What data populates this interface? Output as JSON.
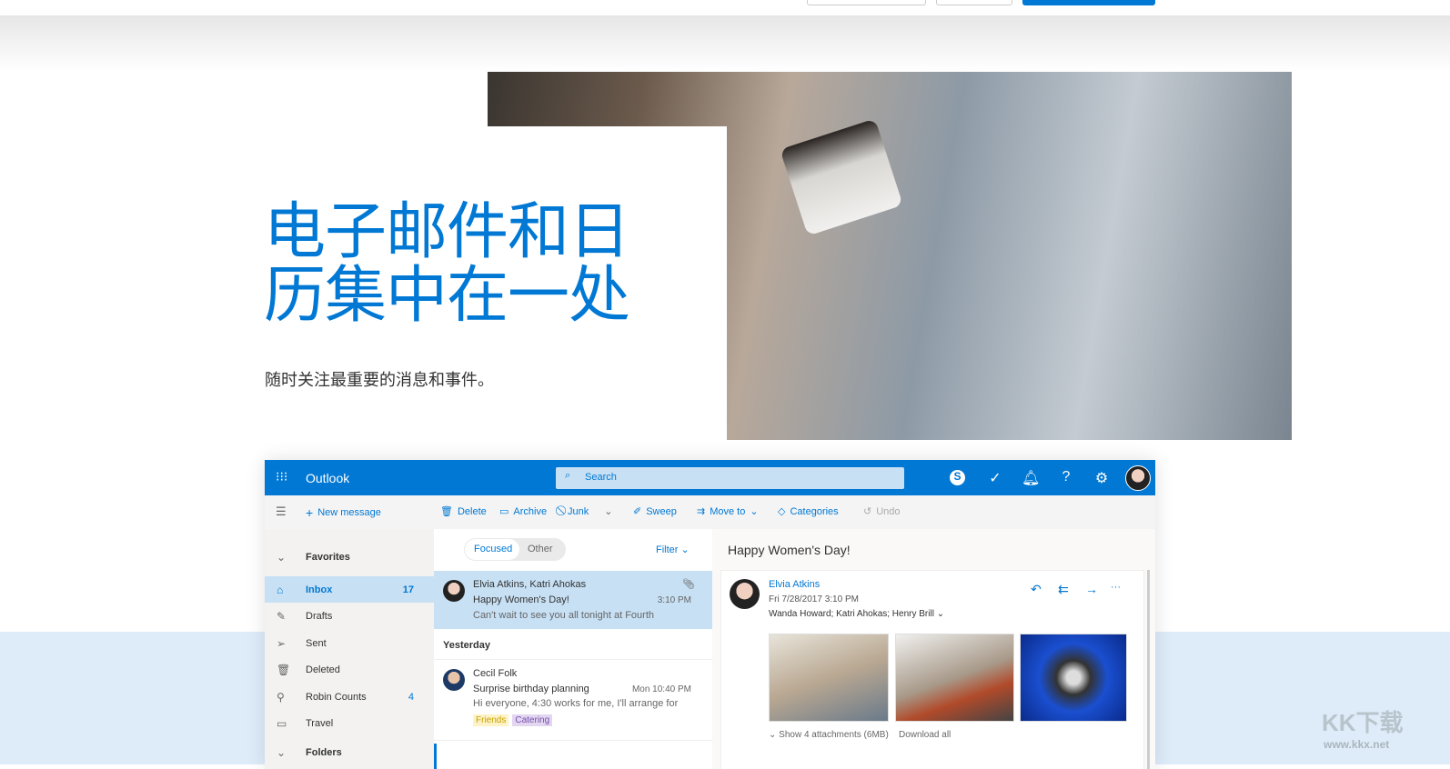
{
  "hero": {
    "headline": "电子邮件和日历集中在一处",
    "subtitle": "随时关注最重要的消息和事件。"
  },
  "colors": {
    "accent": "#0078d4",
    "band": "#deecf9"
  },
  "outlook": {
    "app_name": "Outlook",
    "search_placeholder": "Search",
    "toolbar": {
      "new_message": "New message",
      "delete": "Delete",
      "archive": "Archive",
      "junk": "Junk",
      "sweep": "Sweep",
      "move_to": "Move to",
      "categories": "Categories",
      "undo": "Undo"
    },
    "nav": {
      "favorites": "Favorites",
      "items": [
        {
          "label": "Inbox",
          "count": "17"
        },
        {
          "label": "Drafts"
        },
        {
          "label": "Sent"
        },
        {
          "label": "Deleted"
        },
        {
          "label": "Robin Counts",
          "count": "4"
        },
        {
          "label": "Travel"
        }
      ],
      "folders": "Folders"
    },
    "list": {
      "tab_focused": "Focused",
      "tab_other": "Other",
      "filter": "Filter",
      "group_yesterday": "Yesterday",
      "messages": [
        {
          "from": "Elvia Atkins, Katri Ahokas",
          "subject": "Happy Women's Day!",
          "time": "3:10 PM",
          "preview": "Can't wait to see you all tonight at Fourth"
        },
        {
          "from": "Cecil Folk",
          "subject": "Surprise birthday planning",
          "time": "Mon 10:40 PM",
          "preview": "Hi everyone, 4:30 works for me, I'll arrange for",
          "tags": [
            "Friends",
            "Catering"
          ]
        }
      ]
    },
    "reading": {
      "subject": "Happy Women's Day!",
      "sender": "Elvia Atkins",
      "date": "Fri 7/28/2017 3:10 PM",
      "recipients": "Wanda Howard; Katri Ahokas; Henry Brill",
      "show_attachments": "Show 4 attachments (6MB)",
      "download_all": "Download all"
    }
  },
  "watermark": {
    "logo": "KK下载",
    "url": "www.kkx.net"
  }
}
